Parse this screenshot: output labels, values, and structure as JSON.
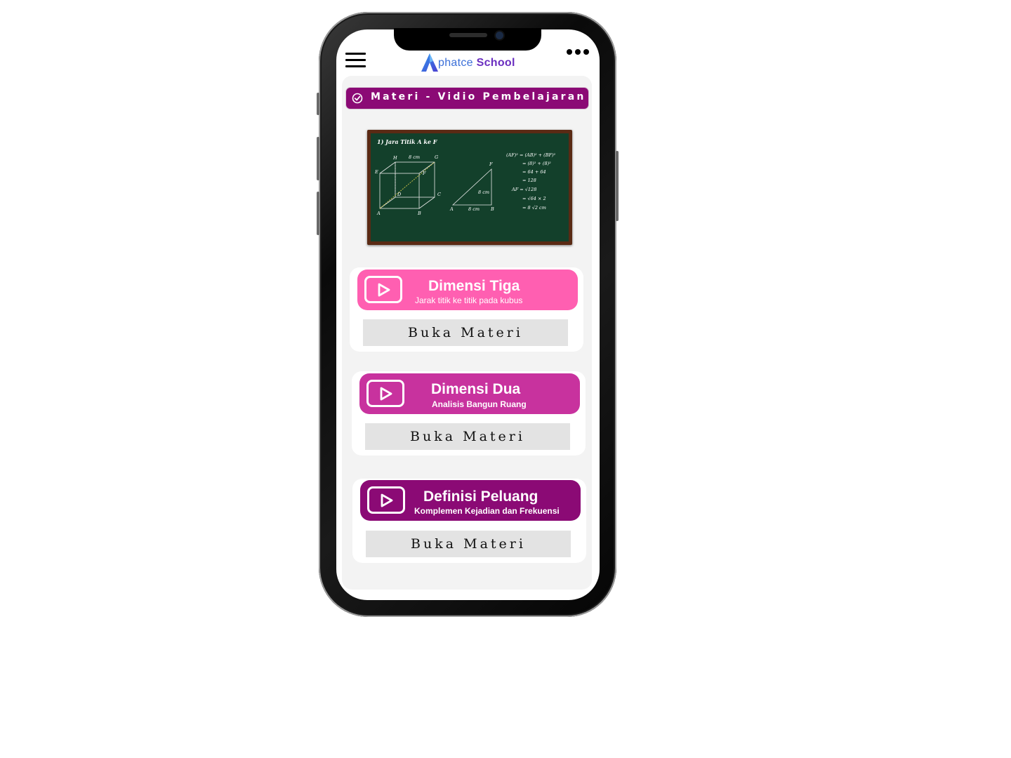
{
  "app": {
    "logo_part1": "phatce",
    "logo_part2": "School"
  },
  "section": {
    "title": "Materi - Vidio Pembelajaran"
  },
  "board": {
    "heading": "1) Jara Titik A ke F",
    "cube_labels": [
      "H",
      "8 cm",
      "G",
      "E",
      "F",
      "D",
      "C",
      "A",
      "B"
    ],
    "triangle_labels": [
      "F",
      "8 cm",
      "A",
      "8 cm",
      "B"
    ],
    "equations": [
      "(AF)² = (AB)² + (BF)²",
      "= (8)² + (8)²",
      "= 64 + 64",
      "= 128",
      "AF = √128",
      "= √64 × 2",
      "= 8 √2  cm"
    ]
  },
  "courses": [
    {
      "title": "Dimensi Tiga",
      "subtitle": "Jarak titik ke titik pada kubus",
      "button": "Buka Materi",
      "color": "#ff5fb1"
    },
    {
      "title": "Dimensi Dua",
      "subtitle": "Analisis Bangun Ruang",
      "button": "Buka Materi",
      "color": "#c8329e"
    },
    {
      "title": "Definisi Peluang",
      "subtitle": "Komplemen Kejadian dan Frekuensi",
      "button": "Buka Materi",
      "color": "#8b0a75"
    }
  ]
}
